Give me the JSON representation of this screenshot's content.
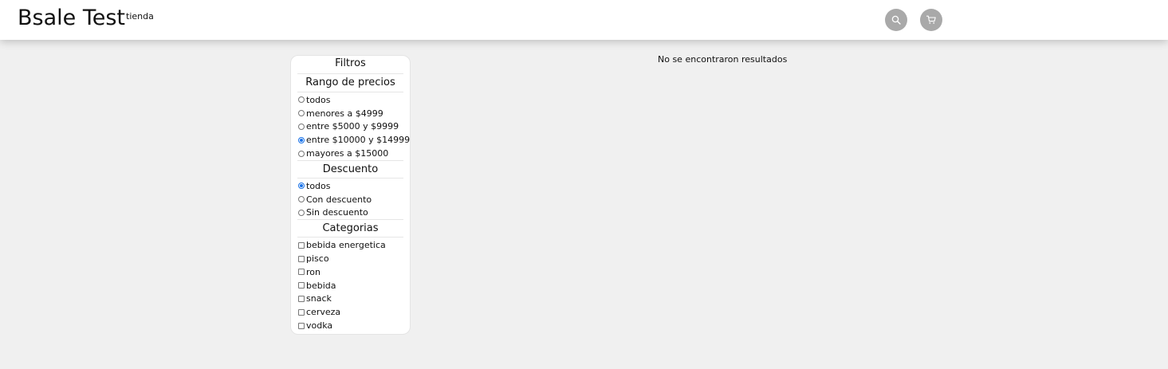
{
  "header": {
    "brand": "Bsale Test",
    "brand_sub": "tienda",
    "search_icon": "search-icon",
    "cart_icon": "cart-icon",
    "icon_bg": "#a9a9a9"
  },
  "filters": {
    "title": "Filtros",
    "price": {
      "title": "Rango de precios",
      "options": [
        {
          "label": "todos",
          "checked": false
        },
        {
          "label": "menores a $4999",
          "checked": false
        },
        {
          "label": "entre $5000 y $9999",
          "checked": false
        },
        {
          "label": "entre $10000 y $14999",
          "checked": true
        },
        {
          "label": "mayores a $15000",
          "checked": false
        }
      ]
    },
    "discount": {
      "title": "Descuento",
      "options": [
        {
          "label": "todos",
          "checked": true
        },
        {
          "label": "Con descuento",
          "checked": false
        },
        {
          "label": "Sin descuento",
          "checked": false
        }
      ]
    },
    "categories": {
      "title": "Categorias",
      "options": [
        {
          "label": "bebida energetica",
          "checked": false
        },
        {
          "label": "pisco",
          "checked": false
        },
        {
          "label": "ron",
          "checked": false
        },
        {
          "label": "bebida",
          "checked": false
        },
        {
          "label": "snack",
          "checked": false
        },
        {
          "label": "cerveza",
          "checked": false
        },
        {
          "label": "vodka",
          "checked": false
        }
      ]
    }
  },
  "results": {
    "empty_message": "No se encontraron resultados"
  }
}
